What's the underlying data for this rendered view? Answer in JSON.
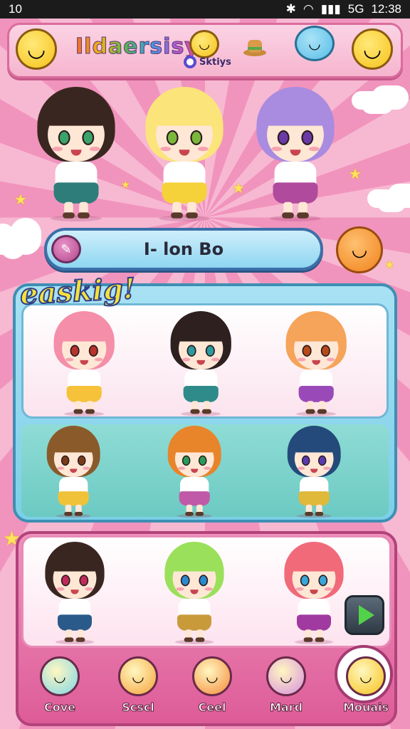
{
  "status_bar": {
    "time_left": "10",
    "clock": "12:38",
    "signal": "5G"
  },
  "header": {
    "title": "Ildaersisy",
    "sub_label": "Sktiys"
  },
  "hero_characters": [
    {
      "name": "hero-character-dark-hair",
      "hair": "#3a2620",
      "eyes": "#3aa36a",
      "skirt": "#2f7d7a"
    },
    {
      "name": "hero-character-blonde",
      "hair": "#fbe47a",
      "eyes": "#7ab83a",
      "skirt": "#f5d23a"
    },
    {
      "name": "hero-character-purple",
      "hair": "#a98be0",
      "eyes": "#6a3aa6",
      "skirt": "#b04a9c"
    }
  ],
  "search": {
    "label": "I- lon Bo"
  },
  "section": {
    "title": "easkig!",
    "row1": [
      {
        "hair": "#f58ea8",
        "eyes": "#b8332e",
        "skirt": "#f5c23a"
      },
      {
        "hair": "#2f2020",
        "eyes": "#2a9aa0",
        "skirt": "#2f8a8a"
      },
      {
        "hair": "#f5a45a",
        "eyes": "#b84a1a",
        "skirt": "#9a4ab8"
      }
    ],
    "row2": [
      {
        "hair": "#8a5a2a",
        "eyes": "#7a3a1a",
        "skirt": "#f0c23a"
      },
      {
        "hair": "#e8842a",
        "eyes": "#2a9a5a",
        "skirt": "#c05aa8"
      },
      {
        "hair": "#234a7a",
        "eyes": "#5a3ab0",
        "skirt": "#e0b83a"
      }
    ]
  },
  "bottom_characters": [
    {
      "hair": "#3a2620",
      "eyes": "#c02a5a",
      "skirt": "#2a5a8a"
    },
    {
      "hair": "#9be05a",
      "eyes": "#2a8ad0",
      "skirt": "#c89a3a"
    },
    {
      "hair": "#f06a7a",
      "eyes": "#3aa6d8",
      "skirt": "#a03aa0"
    }
  ],
  "nav": [
    {
      "label": "Cove",
      "icon": "vase-icon"
    },
    {
      "label": "Scscl",
      "icon": "orange-fruit-icon"
    },
    {
      "label": "Ceel",
      "icon": "orange-face-icon"
    },
    {
      "label": "Mard",
      "icon": "berry-icon"
    },
    {
      "label": "Mouais",
      "icon": "smiley-star-icon"
    }
  ],
  "colors": {
    "accent_pink": "#f194bd",
    "panel_blue": "#7bcfe8",
    "play_green": "#52d24a"
  }
}
